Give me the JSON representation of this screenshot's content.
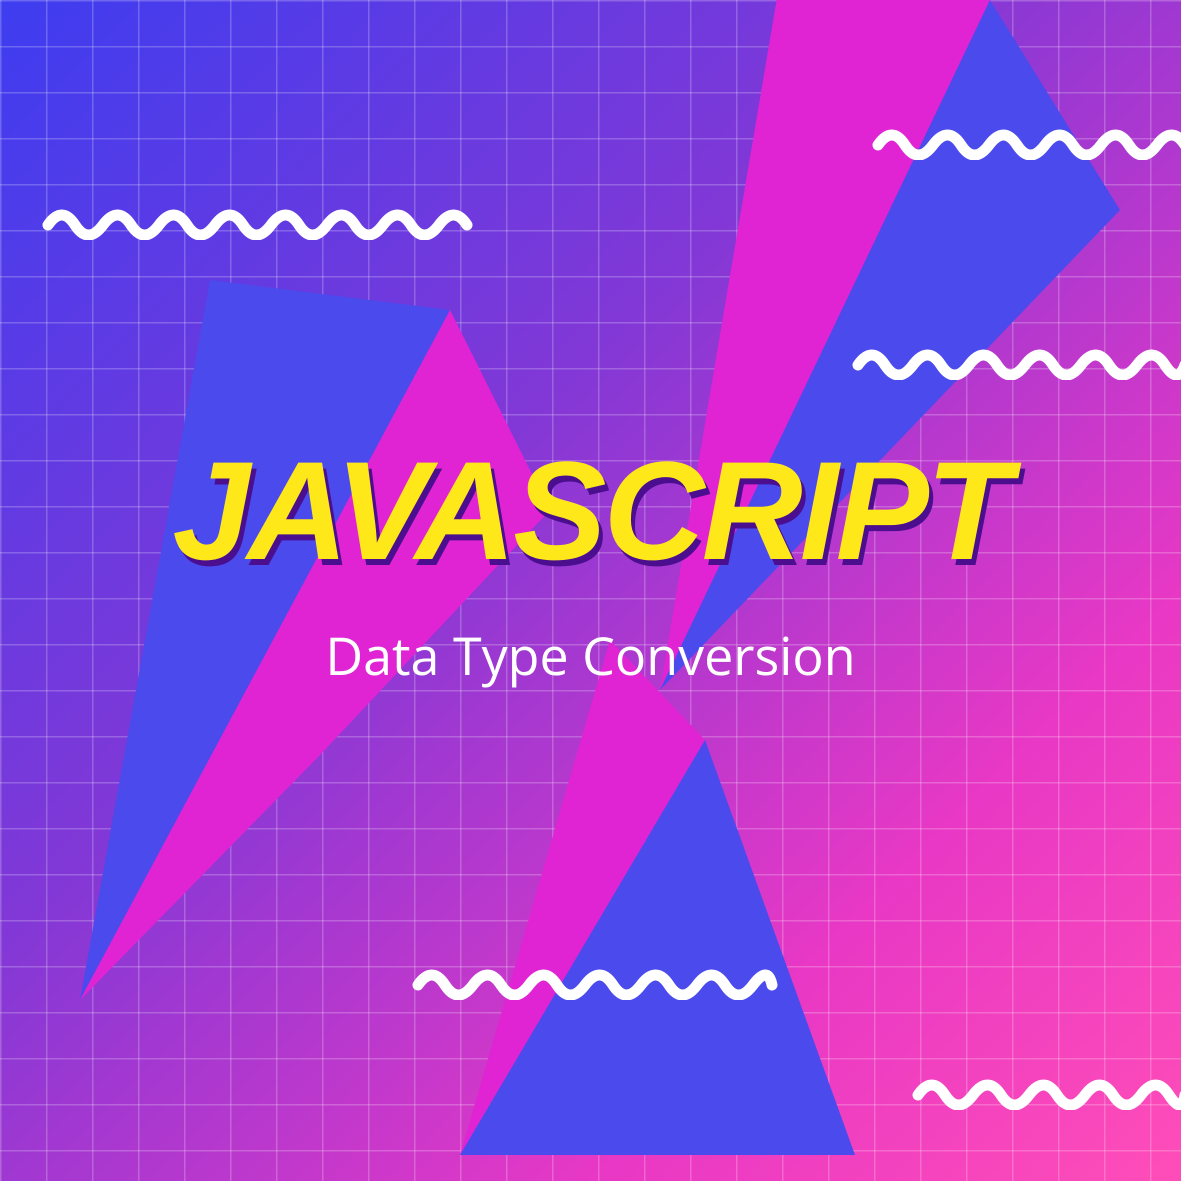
{
  "title": "JAVASCRIPT",
  "subtitle": "Data Type Conversion",
  "colors": {
    "title_color": "#ffe81a",
    "title_shadow": "#4a0e8f",
    "subtitle_color": "#ffffff",
    "squiggle_color": "#ffffff",
    "gradient_start": "#3d3df0",
    "gradient_mid": "#8238d6",
    "gradient_end": "#ff4db8",
    "shape_blue": "#4a4aed",
    "shape_magenta": "#e024d4"
  }
}
